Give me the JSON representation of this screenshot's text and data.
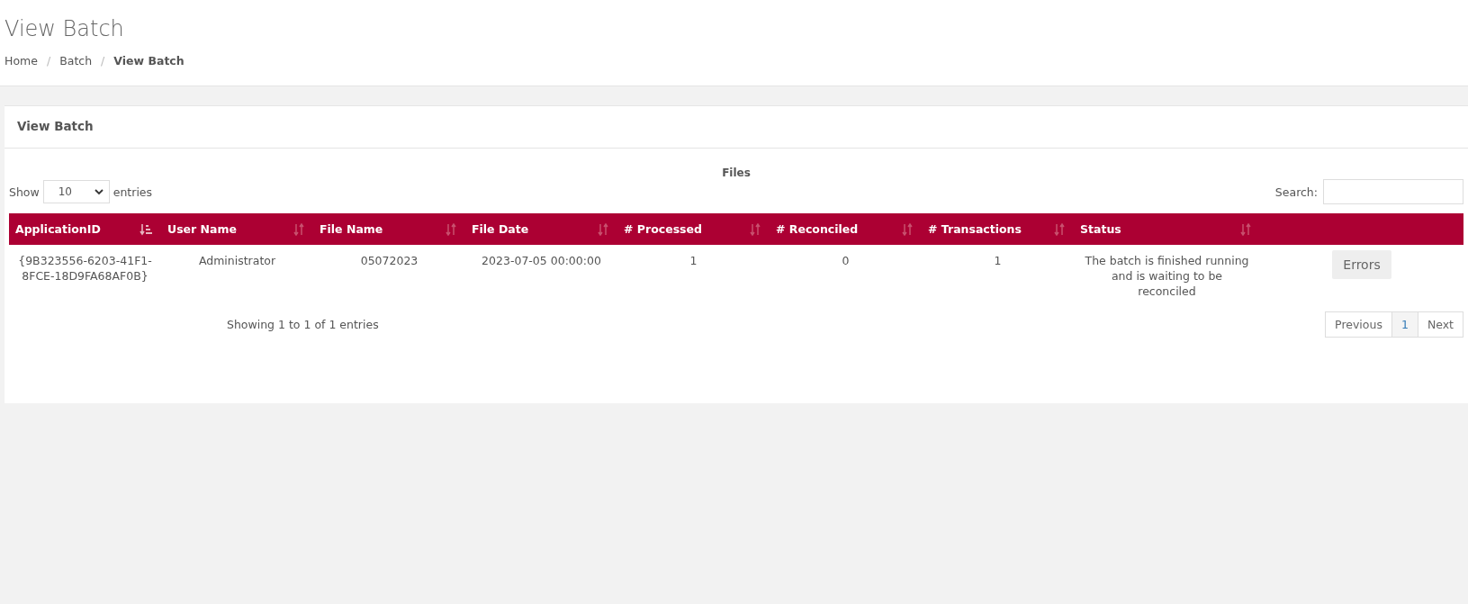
{
  "page_title": "View Batch",
  "breadcrumb_separator": "/",
  "breadcrumb": [
    {
      "label": "Home",
      "current": false
    },
    {
      "label": "Batch",
      "current": false
    },
    {
      "label": "View Batch",
      "current": true
    }
  ],
  "panel": {
    "title": "View Batch",
    "table_caption": "Files",
    "length": {
      "label_before": "Show",
      "value": "10",
      "label_after": "entries"
    },
    "search": {
      "label": "Search:"
    },
    "table": {
      "columns": [
        {
          "label": "ApplicationID",
          "sorted": true
        },
        {
          "label": "User Name",
          "sorted": false
        },
        {
          "label": "File Name",
          "sorted": false
        },
        {
          "label": "File Date",
          "sorted": false
        },
        {
          "label": "# Processed",
          "sorted": false
        },
        {
          "label": "# Reconciled",
          "sorted": false
        },
        {
          "label": "# Transactions",
          "sorted": false
        },
        {
          "label": "Status",
          "sorted": false
        }
      ],
      "rows": [
        {
          "cells": [
            "{9B323556-6203-41F1-8FCE-18D9FA68AF0B}",
            "Administrator",
            "05072023",
            "2023-07-05 00:00:00",
            "1",
            "0",
            "1",
            "The batch is finished running and is waiting to be reconciled"
          ],
          "action": "Errors"
        }
      ]
    },
    "info": "Showing 1 to 1 of 1 entries",
    "pagination": [
      {
        "label": "Previous",
        "selected": false
      },
      {
        "label": "1",
        "selected": true
      },
      {
        "label": "Next",
        "selected": false
      }
    ]
  }
}
